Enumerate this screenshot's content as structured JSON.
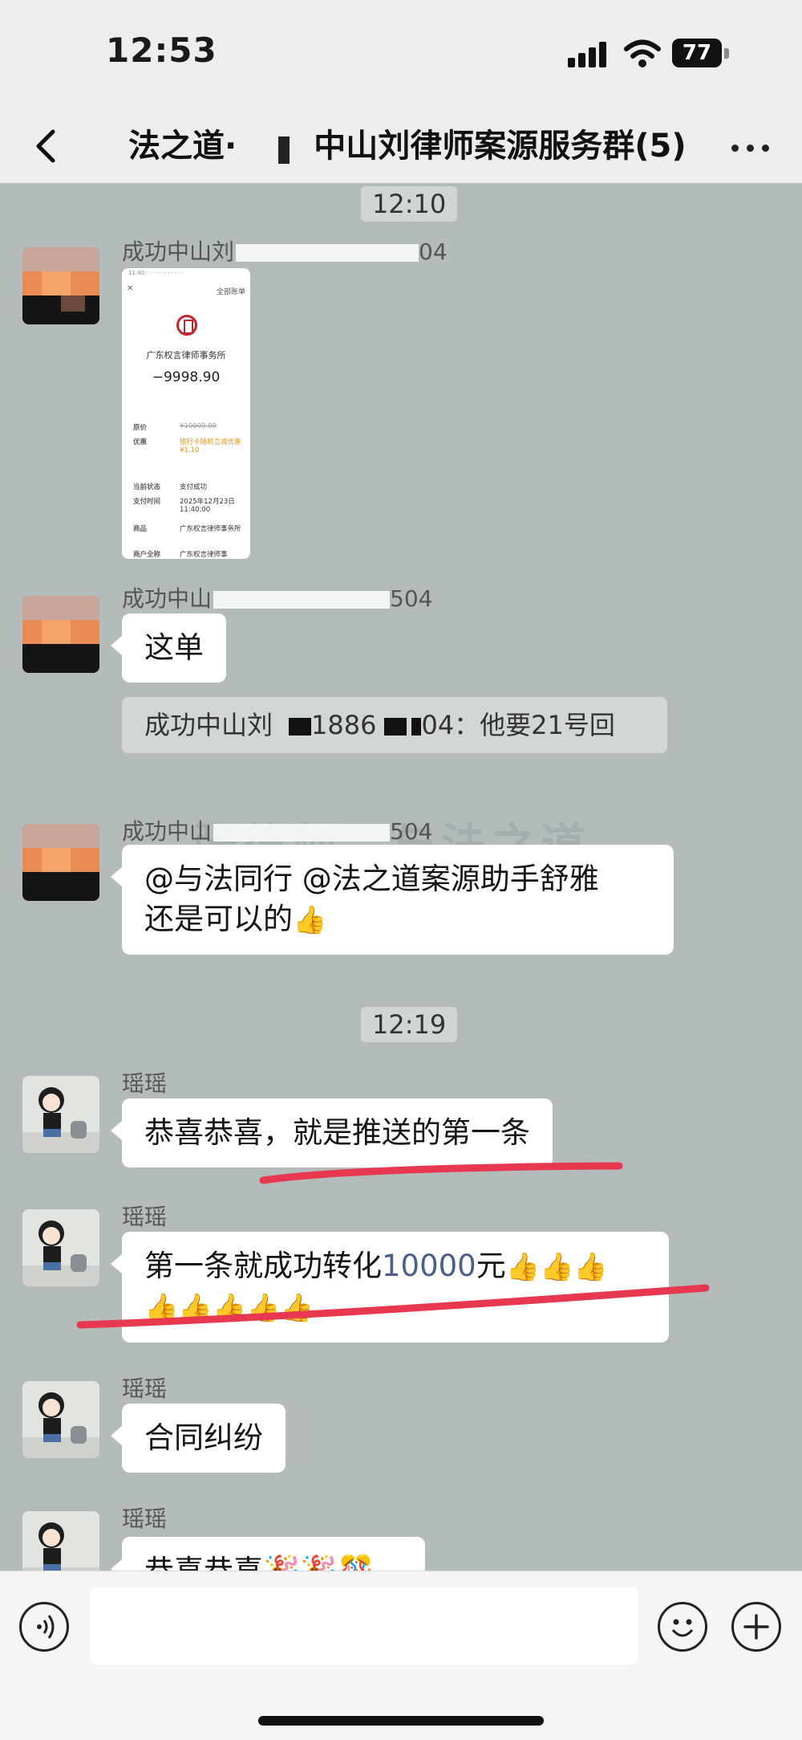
{
  "status": {
    "time": "12:53",
    "battery": "77"
  },
  "nav": {
    "title_prefix": "法之道·",
    "title_suffix": "中山刘律师案源服务群(5)"
  },
  "chat": {
    "watermark": "张律师…与法之道",
    "timestamps": [
      "12:10",
      "12:19"
    ],
    "messages": [
      {
        "sender": "成功中山刘",
        "sender_tail": "04",
        "type": "image",
        "receipt": {
          "close": "✕",
          "all_bills": "全部账单",
          "merchant": "广东权言律师事务所",
          "amount": "−9998.90",
          "rows": [
            {
              "label": "原价",
              "value": "¥10000.00"
            },
            {
              "label": "优惠",
              "value": "银行卡随机立减优惠¥1.10"
            },
            {
              "label": "当前状态",
              "value": "支付成功"
            },
            {
              "label": "支付时间",
              "value": "2025年12月23日 11:40:00"
            },
            {
              "label": "商品",
              "value": "广东权言律师事务所"
            },
            {
              "label": "商户全称",
              "value": "广东权言律师事"
            }
          ]
        }
      },
      {
        "sender": "成功中山",
        "sender_tail": "504",
        "type": "text",
        "text": "这单"
      },
      {
        "type": "quote",
        "quote_a": "成功中山刘",
        "quote_b": "1886",
        "quote_c": "04：他要21号回"
      },
      {
        "sender": "成功中山",
        "sender_tail": "504",
        "type": "text",
        "text_line1": "@与法同行  @法之道案源助手舒雅",
        "text_line2": "还是可以的"
      },
      {
        "sender": "瑶瑶",
        "type": "text",
        "text": "恭喜恭喜，就是推送的第一条"
      },
      {
        "sender": "瑶瑶",
        "type": "text",
        "text_a": "第一条就成功转化",
        "text_amount": "10000",
        "text_b": "元"
      },
      {
        "sender": "瑶瑶",
        "type": "text",
        "text": "合同纠纷"
      },
      {
        "sender": "瑶瑶",
        "type": "text",
        "text": "恭喜恭喜"
      }
    ],
    "thumbs_emoji": "👍",
    "party_emoji": "🎉🎉🎊"
  },
  "colors": {
    "underline": "#e8384f",
    "link_blue": "#4b5f8a",
    "chat_bg": "#b4bcbb"
  },
  "icons": [
    "back-chevron",
    "more-dots",
    "voice",
    "emoji",
    "plus"
  ]
}
